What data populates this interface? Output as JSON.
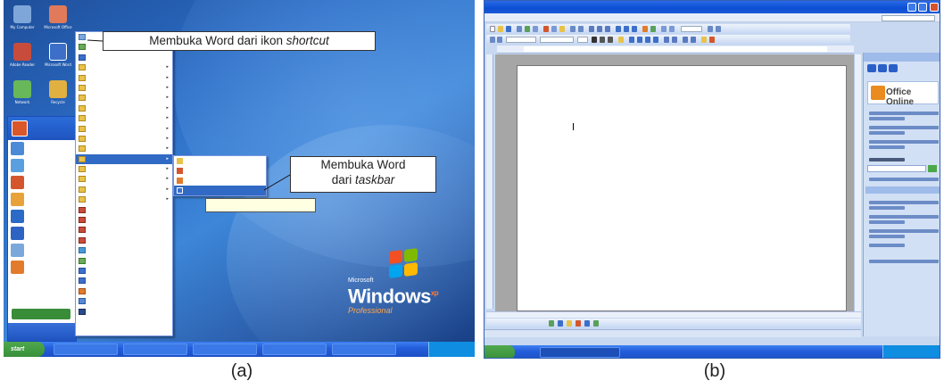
{
  "panel_a": {
    "callout_shortcut": {
      "text": "Membuka Word dari ikon ",
      "emph": "shortcut"
    },
    "callout_taskbar": {
      "line1": "Membuka Word",
      "text": "dari ",
      "emph": "taskbar"
    },
    "start_menu": {
      "start_label": "start"
    },
    "windows_logo": {
      "brand": "Microsoft",
      "name": "Windows",
      "edition": "Professional",
      "xp": "xp"
    },
    "colors": {
      "desktop_blue": "#2a6bc4",
      "taskbar_blue": "#245edb",
      "start_green": "#38903a",
      "menu_highlight": "#316ac5"
    }
  },
  "panel_b": {
    "task_pane": {
      "title_logo": "Office Online"
    },
    "colors": {
      "titlebar_blue": "#0b4ed3",
      "toolbar_blue": "#c4d6f3",
      "page_bg": "#ffffff",
      "workspace_gray": "#a6a6a6"
    }
  },
  "captions": {
    "a": "(a)",
    "b": "(b)"
  }
}
